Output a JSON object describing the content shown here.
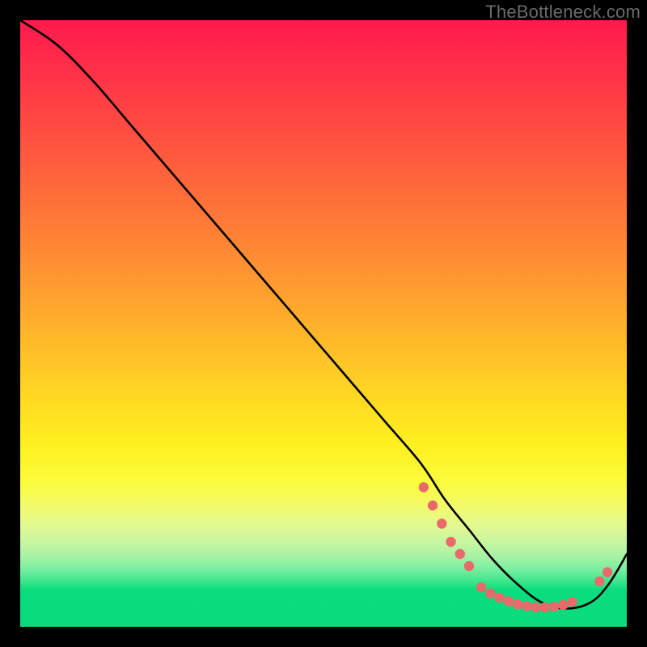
{
  "watermark": "TheBottleneck.com",
  "chart_data": {
    "type": "line",
    "title": "",
    "xlabel": "",
    "ylabel": "",
    "xlim": [
      0,
      100
    ],
    "ylim": [
      0,
      100
    ],
    "grid": false,
    "legend": false,
    "series": [
      {
        "name": "bottleneck-curve",
        "color": "#000000",
        "x": [
          0,
          6,
          12,
          18,
          24,
          30,
          36,
          42,
          48,
          54,
          60,
          66,
          70,
          74,
          78,
          82,
          86,
          90,
          94,
          97,
          100
        ],
        "values": [
          100,
          96,
          90,
          83,
          76,
          69,
          62,
          55,
          48,
          41,
          34,
          27,
          21,
          16,
          11,
          7,
          4,
          3,
          4,
          7,
          12
        ]
      }
    ],
    "markers": [
      {
        "name": "cluster-left",
        "color": "#e96a6a",
        "points": [
          {
            "x": 66.5,
            "y": 23
          },
          {
            "x": 68,
            "y": 20
          },
          {
            "x": 69.5,
            "y": 17
          },
          {
            "x": 71,
            "y": 14
          },
          {
            "x": 72.5,
            "y": 12
          },
          {
            "x": 74,
            "y": 10
          }
        ]
      },
      {
        "name": "cluster-bottom",
        "color": "#e96a6a",
        "points": [
          {
            "x": 76,
            "y": 6.5
          },
          {
            "x": 77.5,
            "y": 5.5
          },
          {
            "x": 79,
            "y": 4.8
          },
          {
            "x": 80.5,
            "y": 4.2
          },
          {
            "x": 82,
            "y": 3.7
          },
          {
            "x": 83.5,
            "y": 3.4
          },
          {
            "x": 85,
            "y": 3.2
          },
          {
            "x": 86.5,
            "y": 3.2
          },
          {
            "x": 88,
            "y": 3.3
          },
          {
            "x": 89.5,
            "y": 3.6
          },
          {
            "x": 91,
            "y": 4.1
          }
        ]
      },
      {
        "name": "cluster-right",
        "color": "#e96a6a",
        "points": [
          {
            "x": 95.5,
            "y": 7.5
          },
          {
            "x": 96.8,
            "y": 9
          }
        ]
      }
    ],
    "background_gradient": {
      "type": "vertical",
      "stops": [
        {
          "pos": 0.0,
          "color": "#ff1a4d"
        },
        {
          "pos": 0.3,
          "color": "#ff7a36"
        },
        {
          "pos": 0.55,
          "color": "#ffcf26"
        },
        {
          "pos": 0.72,
          "color": "#fff823"
        },
        {
          "pos": 0.86,
          "color": "#c9f6a1"
        },
        {
          "pos": 0.93,
          "color": "#23e285"
        },
        {
          "pos": 1.0,
          "color": "#08dc7c"
        }
      ]
    }
  }
}
